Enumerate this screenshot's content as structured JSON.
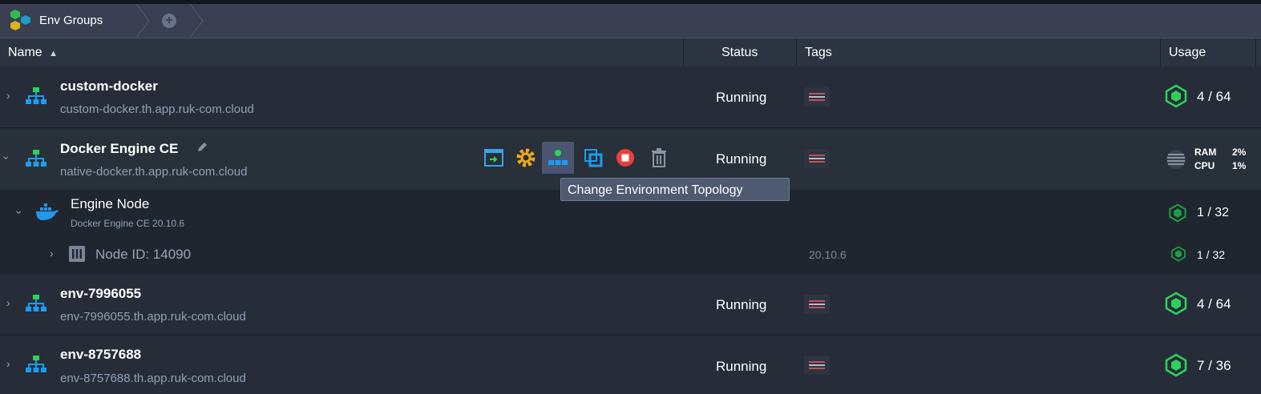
{
  "toolbar": {
    "tab_label": "Env Groups",
    "add_tab": "+"
  },
  "header": {
    "name": "Name",
    "sort": "▲",
    "status": "Status",
    "tags": "Tags",
    "usage": "Usage"
  },
  "environments": [
    {
      "name": "custom-docker",
      "url": "custom-docker.th.app.ruk-com.cloud",
      "status": "Running",
      "usage": "4 / 64"
    },
    {
      "name": "Docker Engine CE",
      "url": "native-docker.th.app.ruk-com.cloud",
      "status": "Running",
      "ram_label": "RAM",
      "ram_value": "2%",
      "cpu_label": "CPU",
      "cpu_value": "1%"
    },
    {
      "name": "env-7996055",
      "url": "env-7996055.th.app.ruk-com.cloud",
      "status": "Running",
      "usage": "4 / 64"
    },
    {
      "name": "env-8757688",
      "url": "env-8757688.th.app.ruk-com.cloud",
      "status": "Running",
      "usage": "7 / 36"
    }
  ],
  "node_group": {
    "name": "Engine Node",
    "subtitle": "Docker Engine CE 20.10.6",
    "usage": "1 / 32"
  },
  "node": {
    "id_label": "Node ID: 14090",
    "version": "20.10.6",
    "usage": "1 / 32"
  },
  "tooltip": "Change Environment Topology",
  "colors": {
    "accent_green": "#2fd15a",
    "toolbar_bg": "#3a3f52",
    "row_bg": "#262d38",
    "url_text": "#8fa0b8",
    "topology_blue": "#1e9bf0",
    "tag_red": "#c0525e"
  },
  "icons": [
    "env-groups-logo-icon",
    "topology-icon",
    "docker-whale-icon",
    "node-icon",
    "open-in-browser-icon",
    "settings-icon",
    "change-topology-icon",
    "clone-icon",
    "stop-icon",
    "delete-icon",
    "edit-pencil-icon",
    "cloudlet-icon",
    "ram-cpu-icon"
  ]
}
